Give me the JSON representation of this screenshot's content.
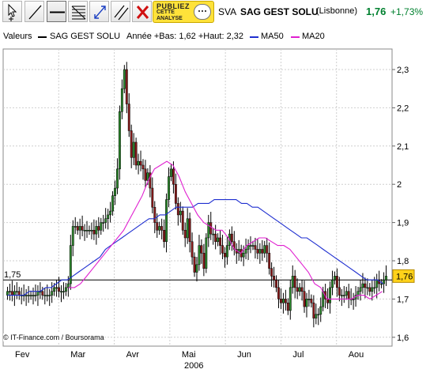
{
  "toolbar": {
    "tools": [
      {
        "name": "cursor-tool-button",
        "icon": "cursor-plus-icon"
      },
      {
        "name": "trendline-tool-button",
        "icon": "diagonal-line-icon"
      },
      {
        "name": "horizontal-line-tool-button",
        "icon": "horizontal-line-icon",
        "active": true
      },
      {
        "name": "fibonacci-tool-button",
        "icon": "fibonacci-lines-icon"
      },
      {
        "name": "zoom-tool-button",
        "icon": "expand-arrows-icon"
      },
      {
        "name": "parallel-channel-tool-button",
        "icon": "parallel-lines-icon"
      },
      {
        "name": "delete-tool-button",
        "icon": "red-cross-icon"
      }
    ],
    "ad": {
      "line1": "PUBLIEZ",
      "line2": "CETTE",
      "line3": "ANALYSE"
    }
  },
  "ticker": {
    "code": "SVA",
    "name": "SAG GEST SOLU",
    "market": "(Lisbonne)",
    "price": "1,76",
    "change": "+1,73%",
    "change_color": "#00802f"
  },
  "legend": {
    "label": "Valeurs",
    "series_name": "SAG GEST SOLU",
    "range_text": "Année +Bas: 1,62 +Haut: 2,32",
    "ma50_label": "MA50",
    "ma20_label": "MA20",
    "ma50_color": "#1f2fd0",
    "ma20_color": "#e020d0"
  },
  "credit": "© IT-Finance.com / Boursorama",
  "year": "2006",
  "chart_data": {
    "type": "candlestick",
    "y_ticks": [
      "2,3",
      "2,2",
      "2,1",
      "2",
      "1,9",
      "1,8",
      "1,7",
      "1,6"
    ],
    "ylim": [
      1.58,
      2.36
    ],
    "x_labels": [
      "Fev",
      "Mar",
      "Avr",
      "Mai",
      "Jun",
      "Jul",
      "Aou"
    ],
    "price_line": {
      "value": 1.75,
      "label": "1,75"
    },
    "last_price": {
      "value": 1.76,
      "label": "1,76"
    },
    "grid": true,
    "candle_up_color": "#2e8b2e",
    "candle_down_color": "#8b1a1a",
    "closes": [
      1.72,
      1.72,
      1.71,
      1.72,
      1.72,
      1.71,
      1.71,
      1.71,
      1.71,
      1.71,
      1.71,
      1.71,
      1.71,
      1.72,
      1.72,
      1.71,
      1.71,
      1.71,
      1.71,
      1.72,
      1.73,
      1.73,
      1.72,
      1.72,
      1.72,
      1.73,
      1.74,
      1.84,
      1.89,
      1.89,
      1.88,
      1.89,
      1.88,
      1.88,
      1.88,
      1.88,
      1.88,
      1.87,
      1.89,
      1.88,
      1.9,
      1.9,
      1.91,
      1.92,
      1.93,
      1.97,
      1.99,
      2.04,
      2.19,
      2.25,
      2.3,
      2.21,
      2.14,
      2.07,
      2.11,
      2.05,
      2.06,
      2.05,
      2.04,
      2.01,
      2.03,
      1.99,
      1.94,
      1.9,
      1.88,
      1.89,
      1.88,
      1.85,
      1.96,
      2.02,
      2.04,
      2.0,
      1.95,
      1.92,
      1.93,
      1.88,
      1.86,
      1.91,
      1.85,
      1.81,
      1.77,
      1.79,
      1.84,
      1.82,
      1.78,
      1.86,
      1.9,
      1.87,
      1.87,
      1.85,
      1.86,
      1.84,
      1.82,
      1.81,
      1.84,
      1.87,
      1.85,
      1.83,
      1.82,
      1.83,
      1.81,
      1.82,
      1.83,
      1.84,
      1.84,
      1.84,
      1.83,
      1.82,
      1.83,
      1.82,
      1.84,
      1.82,
      1.78,
      1.76,
      1.75,
      1.73,
      1.7,
      1.69,
      1.7,
      1.69,
      1.67,
      1.73,
      1.76,
      1.73,
      1.72,
      1.73,
      1.72,
      1.68,
      1.7,
      1.7,
      1.69,
      1.65,
      1.66,
      1.66,
      1.68,
      1.72,
      1.7,
      1.69,
      1.73,
      1.75,
      1.76,
      1.73,
      1.71,
      1.71,
      1.71,
      1.72,
      1.7,
      1.7,
      1.7,
      1.71,
      1.72,
      1.73,
      1.74,
      1.73,
      1.73,
      1.72,
      1.73,
      1.73,
      1.75,
      1.74,
      1.74,
      1.75,
      1.76
    ],
    "ma50": [
      1.71,
      1.71,
      1.71,
      1.71,
      1.72,
      1.72,
      1.72,
      1.73,
      1.73,
      1.74,
      1.75,
      1.75,
      1.76,
      1.77,
      1.78,
      1.79,
      1.8,
      1.81,
      1.83,
      1.84,
      1.85,
      1.86,
      1.87,
      1.88,
      1.89,
      1.9,
      1.91,
      1.91,
      1.92,
      1.92,
      1.93,
      1.94,
      1.94,
      1.94,
      1.94,
      1.95,
      1.95,
      1.95,
      1.96,
      1.96,
      1.96,
      1.96,
      1.96,
      1.95,
      1.95,
      1.94,
      1.94,
      1.93,
      1.92,
      1.91,
      1.9,
      1.89,
      1.88,
      1.87,
      1.86,
      1.86,
      1.85,
      1.84,
      1.83,
      1.82,
      1.81,
      1.8,
      1.79,
      1.78,
      1.77,
      1.76,
      1.75,
      1.75,
      1.75,
      1.74
    ],
    "ma20": [
      1.73,
      1.73,
      1.74,
      1.76,
      1.78,
      1.8,
      1.82,
      1.84,
      1.86,
      1.88,
      1.91,
      1.94,
      1.97,
      2.01,
      2.04,
      2.05,
      2.06,
      2.05,
      2.02,
      1.98,
      1.95,
      1.92,
      1.9,
      1.89,
      1.88,
      1.88,
      1.86,
      1.83,
      1.82,
      1.84,
      1.85,
      1.86,
      1.86,
      1.85,
      1.84,
      1.84,
      1.83,
      1.81,
      1.79,
      1.77,
      1.74,
      1.73,
      1.7,
      1.7,
      1.7,
      1.7,
      1.7,
      1.71,
      1.71,
      1.7,
      1.71,
      1.72
    ]
  }
}
